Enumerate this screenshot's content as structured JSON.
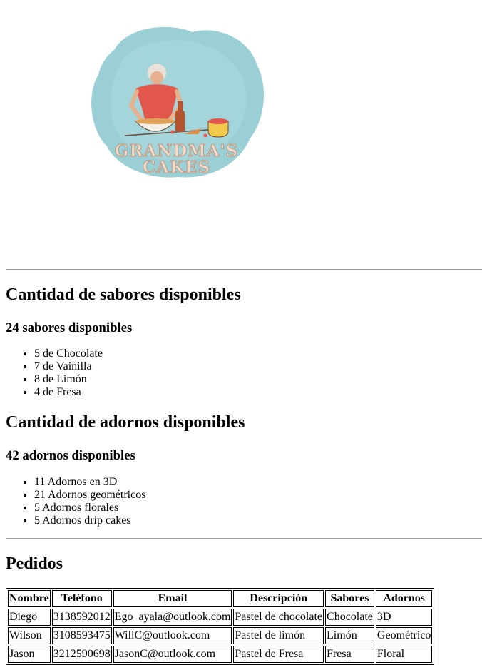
{
  "logo": {
    "line1": "GRANDMA'S",
    "line2": "CAKES",
    "colors": {
      "watercolor": "#8fcbd0",
      "brand_text": "#f1dccb",
      "dress": "#e2574c"
    }
  },
  "flavors": {
    "heading": "Cantidad de sabores disponibles",
    "subheading": "24 sabores disponibles",
    "items": [
      "5 de Chocolate",
      "7 de Vainilla",
      "8 de Limón",
      "4 de Fresa"
    ]
  },
  "decorations": {
    "heading": "Cantidad de adornos disponibles",
    "subheading": "42 adornos disponibles",
    "items": [
      "11 Adornos en 3D",
      "21 Adornos geométricos",
      "5 Adornos florales",
      "5 Adornos drip cakes"
    ]
  },
  "orders": {
    "heading": "Pedidos",
    "columns": [
      "Nombre",
      "Teléfono",
      "Email",
      "Descripción",
      "Sabores",
      "Adornos"
    ],
    "rows": [
      [
        "Diego",
        "3138592012",
        "Ego_ayala@outlook.com",
        "Pastel de chocolate",
        "Chocolate",
        "3D"
      ],
      [
        "Wilson",
        "3108593475",
        "WillC@outlook.com",
        "Pastel de limón",
        "Limón",
        "Geométrico"
      ],
      [
        "Jason",
        "3212590698",
        "JasonC@outlook.com",
        "Pastel de Fresa",
        "Fresa",
        "Floral"
      ]
    ]
  }
}
